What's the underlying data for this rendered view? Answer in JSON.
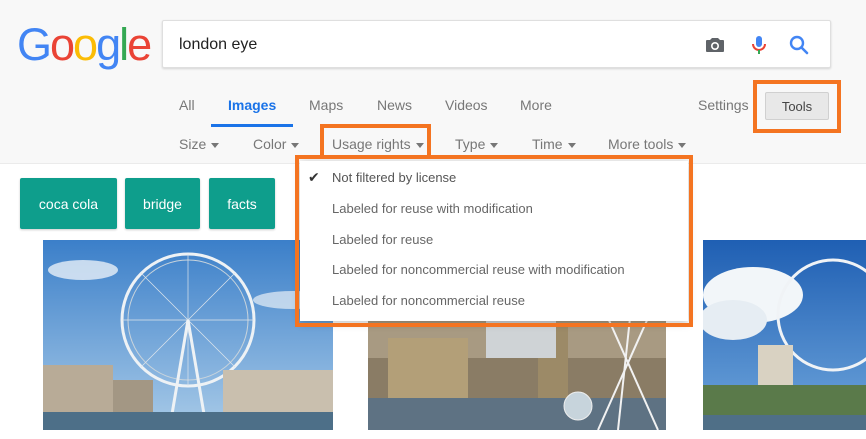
{
  "logo": {
    "letters": [
      "G",
      "o",
      "o",
      "g",
      "l",
      "e"
    ],
    "colors": [
      "#4285f4",
      "#ea4335",
      "#fbbc05",
      "#4285f4",
      "#34a853",
      "#ea4335"
    ]
  },
  "search": {
    "query": "london eye"
  },
  "search_icons": [
    "camera-icon",
    "microphone-icon",
    "search-icon"
  ],
  "tabs": [
    {
      "label": "All",
      "active": false
    },
    {
      "label": "Images",
      "active": true
    },
    {
      "label": "Maps",
      "active": false
    },
    {
      "label": "News",
      "active": false
    },
    {
      "label": "Videos",
      "active": false
    },
    {
      "label": "More",
      "active": false
    }
  ],
  "settings_label": "Settings",
  "tools_label": "Tools",
  "filters": [
    "Size",
    "Color",
    "Usage rights",
    "Type",
    "Time",
    "More tools"
  ],
  "chips": [
    "coca cola",
    "bridge",
    "facts"
  ],
  "usage_menu": {
    "items": [
      {
        "label": "Not filtered by license",
        "checked": true
      },
      {
        "label": "Labeled for reuse with modification",
        "checked": false
      },
      {
        "label": "Labeled for reuse",
        "checked": false
      },
      {
        "label": "Labeled for noncommercial reuse with modification",
        "checked": false
      },
      {
        "label": "Labeled for noncommercial reuse",
        "checked": false
      }
    ]
  },
  "colors": {
    "accent_blue": "#1a73e8",
    "chip_teal": "#0e9e8c",
    "highlight_orange": "#f47421"
  }
}
